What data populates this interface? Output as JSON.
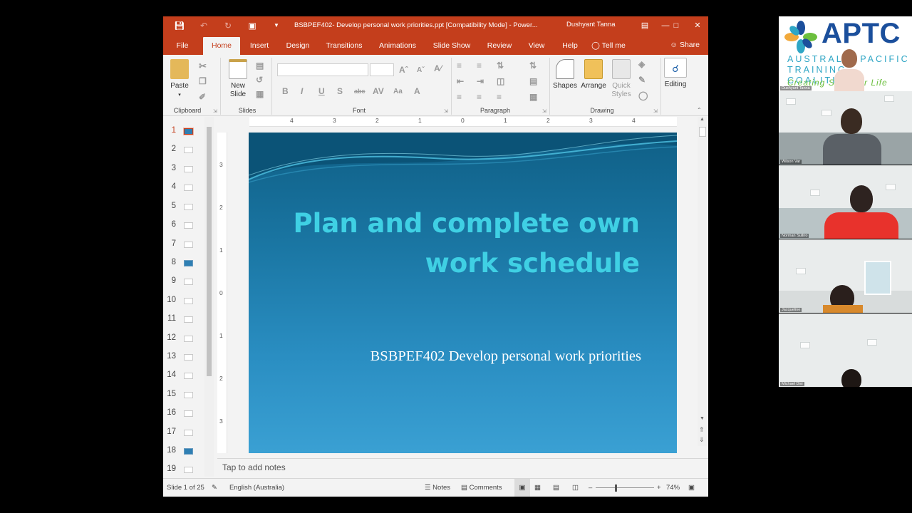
{
  "window": {
    "doc_title": "BSBPEF402- Develop personal work priorities.ppt [Compatibility Mode]  -  Power...",
    "user_name": "Dushyant Tanna"
  },
  "tabs": [
    "File",
    "Home",
    "Insert",
    "Design",
    "Transitions",
    "Animations",
    "Slide Show",
    "Review",
    "View",
    "Help",
    "Tell me"
  ],
  "active_tab": "Home",
  "share_label": "Share",
  "ribbon": {
    "paste": "Paste",
    "new_slide": "New Slide",
    "shapes": "Shapes",
    "arrange": "Arrange",
    "quick_styles": "Quick Styles",
    "editing": "Editing",
    "groups": [
      "Clipboard",
      "Slides",
      "Font",
      "Paragraph",
      "Drawing"
    ]
  },
  "thumbnails": [
    "1",
    "2",
    "3",
    "4",
    "5",
    "6",
    "7",
    "8",
    "9",
    "10",
    "11",
    "12",
    "13",
    "14",
    "15",
    "16",
    "17",
    "18",
    "19"
  ],
  "ruler": {
    "horizontal": [
      "4",
      "3",
      "2",
      "1",
      "0",
      "1",
      "2",
      "3",
      "4"
    ],
    "vertical": [
      "3",
      "2",
      "1",
      "0",
      "1",
      "2",
      "3"
    ]
  },
  "slide": {
    "title_line1": "Plan and complete own",
    "title_line2": "work schedule",
    "subtitle": "BSBPEF402 Develop personal work priorities"
  },
  "notes_placeholder": "Tap to add notes",
  "status": {
    "slide_count": "Slide 1 of 25",
    "language": "English (Australia)",
    "notes": "Notes",
    "comments": "Comments",
    "zoom": "74%"
  },
  "logo": {
    "name": "APTC",
    "sub": "AUSTRALIA PACIFIC TRAINING COALITION",
    "tagline": "Creating Skills for Life"
  },
  "participants": [
    "Dushyant Tanna",
    "Wilson Var",
    "Norman Sulliro",
    "Jacqueline",
    "Michael Dixi"
  ],
  "colors": {
    "accent": "#c43e1c",
    "slide_title": "#3fd0e4",
    "slide_bg": "#1a76a3"
  }
}
